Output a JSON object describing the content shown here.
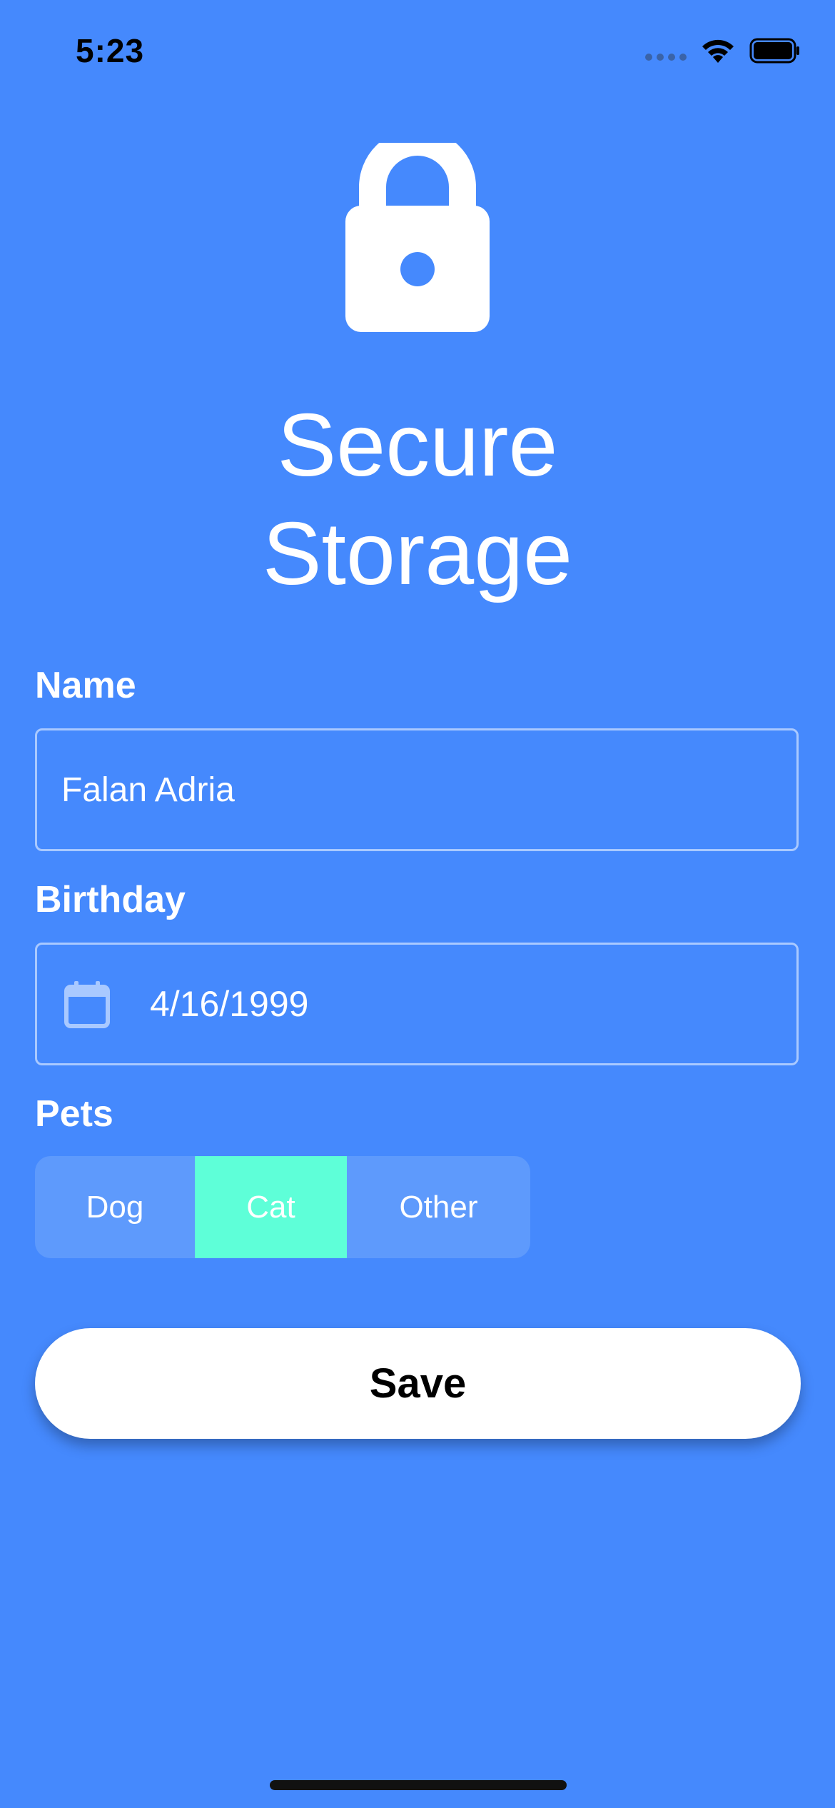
{
  "status_bar": {
    "time": "5:23"
  },
  "icons": {
    "lock": "lock-icon",
    "calendar": "calendar-icon",
    "wifi": "wifi-icon",
    "battery": "battery-icon"
  },
  "title": {
    "line1": "Secure",
    "line2": "Storage"
  },
  "form": {
    "name_label": "Name",
    "name_value": "Falan Adria",
    "birthday_label": "Birthday",
    "birthday_value": "4/16/1999",
    "pets_label": "Pets",
    "pets_options": [
      "Dog",
      "Cat",
      "Other"
    ],
    "pets_selected": "Cat"
  },
  "actions": {
    "save_label": "Save"
  },
  "colors": {
    "background": "#4589fd",
    "selected_segment": "#5effd8",
    "segment_background": "#5e9afc",
    "input_border": "#a9c9ff",
    "button_background": "#ffffff"
  }
}
